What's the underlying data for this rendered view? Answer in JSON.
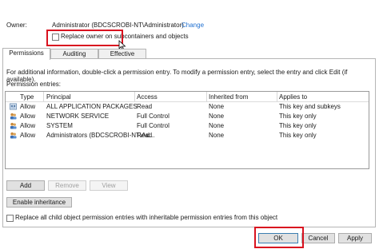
{
  "owner": {
    "label": "Owner:",
    "value": "Administrator (BDCSCROBI-NT\\Administrator)",
    "change_link": "Change",
    "replace_checkbox_label": "Replace owner on subcontainers and objects",
    "replace_checked": false
  },
  "tabs": [
    {
      "label": "Permissions",
      "active": true
    },
    {
      "label": "Auditing",
      "active": false
    },
    {
      "label": "Effective Access",
      "active": false
    }
  ],
  "instructions": "For additional information, double-click a permission entry. To modify a permission entry, select the entry and click Edit (if available).",
  "entries_label": "Permission entries:",
  "table": {
    "columns": [
      "Type",
      "Principal",
      "Access",
      "Inherited from",
      "Applies to"
    ],
    "rows": [
      {
        "type": "Allow",
        "principal": "ALL APPLICATION PACKAGES",
        "access": "Read",
        "inherited": "None",
        "applies": "This key and subkeys",
        "icon": "group-icon"
      },
      {
        "type": "Allow",
        "principal": "NETWORK SERVICE",
        "access": "Full Control",
        "inherited": "None",
        "applies": "This key only",
        "icon": "user-group-icon"
      },
      {
        "type": "Allow",
        "principal": "SYSTEM",
        "access": "Full Control",
        "inherited": "None",
        "applies": "This key only",
        "icon": "user-group-icon"
      },
      {
        "type": "Allow",
        "principal": "Administrators (BDCSCROBI-NT\\Ad...",
        "access": "Read",
        "inherited": "None",
        "applies": "This key only",
        "icon": "user-group-icon"
      }
    ]
  },
  "buttons": {
    "add": "Add",
    "remove": "Remove",
    "view": "View",
    "enable_inheritance": "Enable inheritance",
    "ok": "OK",
    "cancel": "Cancel",
    "apply": "Apply"
  },
  "replace_child_label": "Replace all child object permission entries with inheritable permission entries from this object",
  "replace_child_checked": false,
  "colors": {
    "link": "#1e6fd0",
    "highlight_box": "#d9121f"
  }
}
